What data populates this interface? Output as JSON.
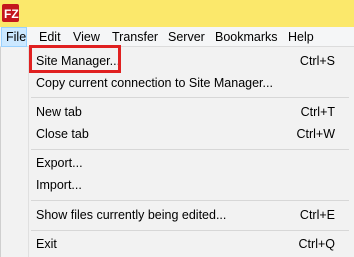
{
  "menubar": {
    "items": [
      {
        "label": "File"
      },
      {
        "label": "Edit"
      },
      {
        "label": "View"
      },
      {
        "label": "Transfer"
      },
      {
        "label": "Server"
      },
      {
        "label": "Bookmarks"
      },
      {
        "label": "Help"
      }
    ]
  },
  "file_menu": {
    "items": [
      {
        "label": "Site Manager...",
        "shortcut": "Ctrl+S"
      },
      {
        "label": "Copy current connection to Site Manager...",
        "shortcut": ""
      },
      {
        "label": "New tab",
        "shortcut": "Ctrl+T"
      },
      {
        "label": "Close tab",
        "shortcut": "Ctrl+W"
      },
      {
        "label": "Export...",
        "shortcut": ""
      },
      {
        "label": "Import...",
        "shortcut": ""
      },
      {
        "label": "Show files currently being edited...",
        "shortcut": "Ctrl+E"
      },
      {
        "label": "Exit",
        "shortcut": "Ctrl+Q"
      }
    ]
  },
  "colors": {
    "titlebar_bg": "#fbe86b",
    "app_icon_red": "#c4161c",
    "active_menu_bg": "#cce8ff",
    "highlight_border": "#e02020"
  },
  "icons": {
    "app_icon": "filezilla-icon"
  }
}
